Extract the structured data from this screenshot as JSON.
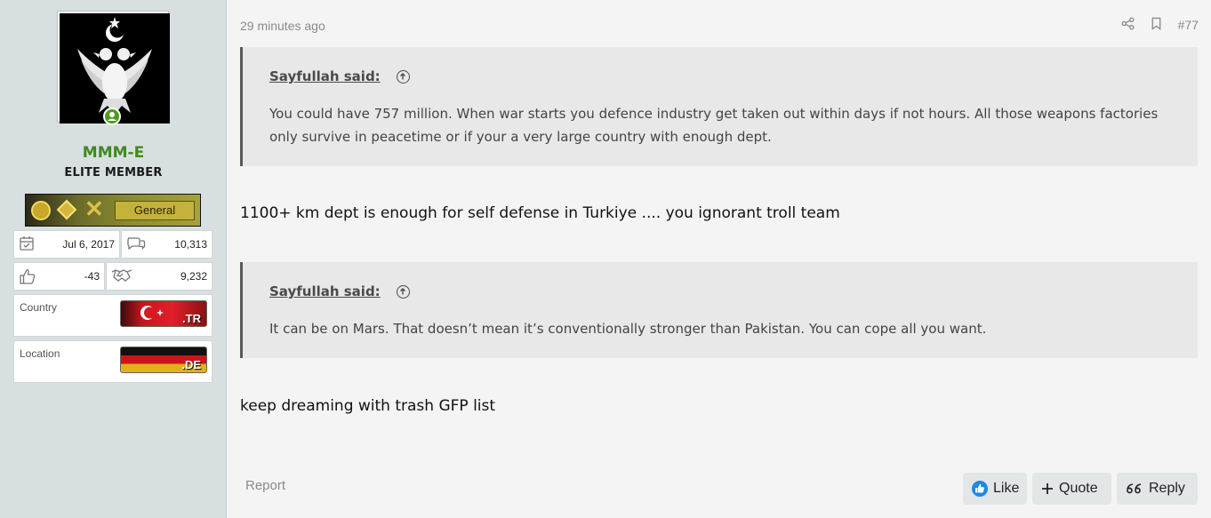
{
  "sidebar": {
    "username": "MMM-E",
    "user_title": "ELITE MEMBER",
    "rank_label": "General",
    "stats": {
      "joined": "Jul 6, 2017",
      "messages": "10,313",
      "reactions": "-43",
      "points": "9,232"
    },
    "country_label": "Country",
    "country_code": ".TR",
    "location_label": "Location",
    "location_code": ".DE"
  },
  "post": {
    "timestamp": "29 minutes ago",
    "post_number": "#77",
    "quotes": [
      {
        "author": "Sayfullah said:",
        "text": "You could have 757 million. When war starts you defence industry get taken out within days if not hours. All those weapons factories only survive in peacetime or if your a very large country with enough dept."
      },
      {
        "author": "Sayfullah said:",
        "text": "It can be on Mars. That doesn’t mean it’s conventionally stronger than Pakistan. You can cope all you want."
      }
    ],
    "reply_1": "1100+ km dept is enough for self defense in Turkiye .... you ignorant troll team",
    "reply_2": "keep dreaming with trash GFP list"
  },
  "footer": {
    "report": "Report",
    "like": "Like",
    "quote": "Quote",
    "reply": "Reply"
  },
  "colors": {
    "username": "#3f8a1f",
    "like_blue": "#1e88e5"
  }
}
